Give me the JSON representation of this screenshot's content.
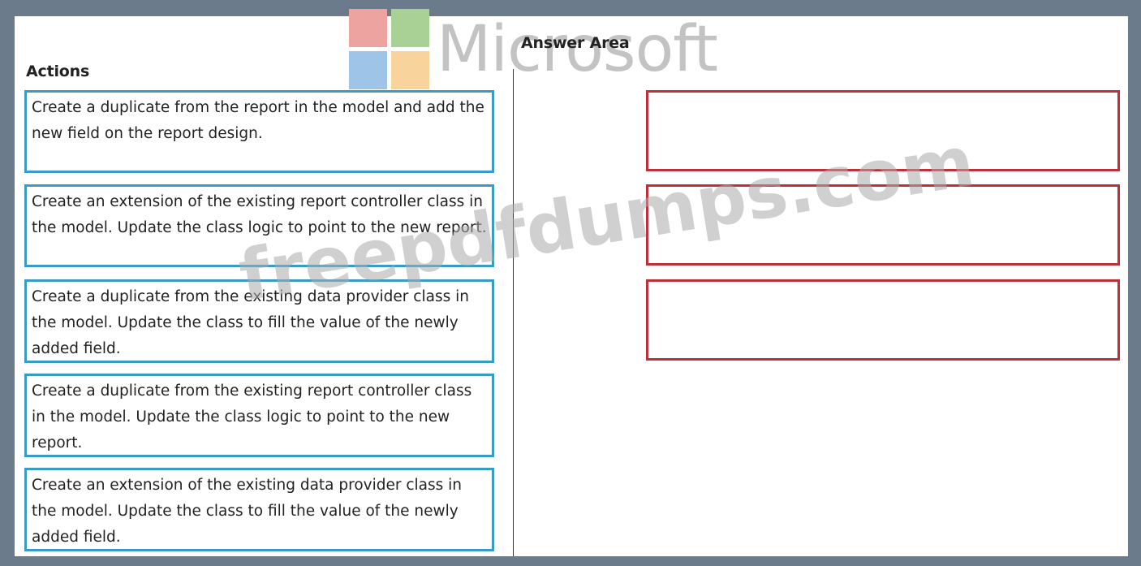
{
  "actions": {
    "title": "Actions",
    "items": [
      {
        "text": "Create a duplicate from the report in the model and add the new field on the report design."
      },
      {
        "text": "Create an extension of the existing report controller class in the model. Update the class logic to point to the new report."
      },
      {
        "text": "Create a duplicate from the existing data provider class in the model. Update the class to fill the value of the newly added field."
      },
      {
        "text": "Create a duplicate from the existing report controller class in the model. Update the class logic to point to the new report."
      },
      {
        "text": "Create an extension of the existing data provider class in the model. Update the class to fill the value of the newly added field."
      }
    ]
  },
  "answer_area": {
    "title": "Answer Area",
    "slots": [
      {
        "text": ""
      },
      {
        "text": ""
      },
      {
        "text": ""
      }
    ]
  },
  "branding": {
    "logo_text": "Microsoft",
    "logo_colors": [
      "#eda3a0",
      "#a9d095",
      "#9ec5e8",
      "#f8d39b"
    ],
    "watermark": "freepdfdumps.com"
  },
  "colors": {
    "action_border": "#3a9bc3",
    "answer_border": "#c0303b",
    "frame": "#6b7b8c"
  }
}
